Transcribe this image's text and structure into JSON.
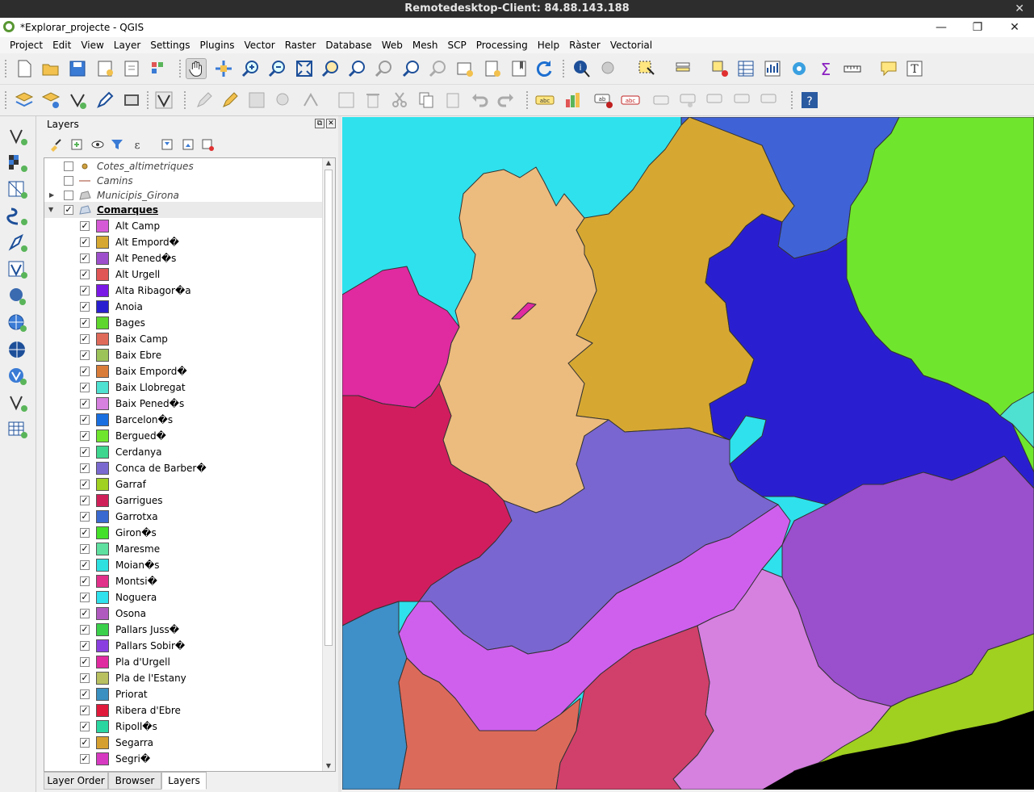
{
  "remote_bar": {
    "title": "Remotedesktop-Client: 84.88.143.188",
    "close": "✕"
  },
  "window": {
    "title": "*Explorar_projecte - QGIS",
    "minimize": "—",
    "restore": "❐",
    "close": "✕"
  },
  "menu": [
    "Project",
    "Edit",
    "View",
    "Layer",
    "Settings",
    "Plugins",
    "Vector",
    "Raster",
    "Database",
    "Web",
    "Mesh",
    "SCP",
    "Processing",
    "Help",
    "Ràster",
    "Vectorial"
  ],
  "panel": {
    "title": "Layers",
    "float": "⧉",
    "close": "✕"
  },
  "layers_top": [
    {
      "name": "Cotes_altimetriques",
      "checked": false
    },
    {
      "name": "Camins",
      "checked": false
    },
    {
      "name": "Municipis_Girona",
      "checked": false
    },
    {
      "name": "Comarques",
      "checked": true
    }
  ],
  "comarques": [
    {
      "name": "Alt Camp",
      "color": "#d55ad6"
    },
    {
      "name": "Alt Empord�",
      "color": "#d6a832"
    },
    {
      "name": "Alt Pened�s",
      "color": "#9e4fcc"
    },
    {
      "name": "Alt Urgell",
      "color": "#e05555"
    },
    {
      "name": "Alta Ribagor�a",
      "color": "#7a18e6"
    },
    {
      "name": "Anoia",
      "color": "#2a1fd0"
    },
    {
      "name": "Bages",
      "color": "#5ed62d"
    },
    {
      "name": "Baix Camp",
      "color": "#e06a5a"
    },
    {
      "name": "Baix Ebre",
      "color": "#9cc25a"
    },
    {
      "name": "Baix Empord�",
      "color": "#d97c3a"
    },
    {
      "name": "Baix Llobregat",
      "color": "#4ee0d0"
    },
    {
      "name": "Baix Pened�s",
      "color": "#d680e0"
    },
    {
      "name": "Barcelon�s",
      "color": "#1a6fe0"
    },
    {
      "name": "Bergued�",
      "color": "#6fe62d"
    },
    {
      "name": "Cerdanya",
      "color": "#3fd690"
    },
    {
      "name": "Conca de Barber�",
      "color": "#7a6ad0"
    },
    {
      "name": "Garraf",
      "color": "#a0d020"
    },
    {
      "name": "Garrigues",
      "color": "#d0205a"
    },
    {
      "name": "Garrotxa",
      "color": "#3a6ad0"
    },
    {
      "name": "Giron�s",
      "color": "#44e02a"
    },
    {
      "name": "Maresme",
      "color": "#5fe0a0"
    },
    {
      "name": "Moian�s",
      "color": "#2ee0e0"
    },
    {
      "name": "Montsi�",
      "color": "#e0308a"
    },
    {
      "name": "Noguera",
      "color": "#2ee1ec"
    },
    {
      "name": "Osona",
      "color": "#b05ac0"
    },
    {
      "name": "Pallars Juss�",
      "color": "#3ad04a"
    },
    {
      "name": "Pallars Sobir�",
      "color": "#8a40e0"
    },
    {
      "name": "Pla d'Urgell",
      "color": "#e02aa0"
    },
    {
      "name": "Pla de l'Estany",
      "color": "#b8c060"
    },
    {
      "name": "Priorat",
      "color": "#3a90c0"
    },
    {
      "name": "Ribera d'Ebre",
      "color": "#e01a3a"
    },
    {
      "name": "Ripoll�s",
      "color": "#2ad6a0"
    },
    {
      "name": "Segarra",
      "color": "#d6a030"
    },
    {
      "name": "Segri�",
      "color": "#d63ac0"
    }
  ],
  "tabs": [
    "Layer Order",
    "Browser",
    "Layers"
  ],
  "map_colors": {
    "noguera": "#2ee1ec",
    "segarra": "#ecbb7e",
    "altempurda": "#d6a832",
    "anoia": "#2a1fd0",
    "garrotxa": "#3f62d6",
    "bergueda": "#6fe62d",
    "plaurgell": "#e02aa0",
    "garrigues": "#d11d5e",
    "conca": "#7a66d0",
    "altcamp": "#cf60ee",
    "baixpenedes": "#d680e0",
    "altpenedes": "#9a4fcc",
    "garraf": "#a0d020",
    "priorat": "#3f8fc8",
    "baixcamp": "#dc6a5a",
    "tarragones": "#d0406a",
    "baixllob": "#4ee0d0",
    "sea": "#000000"
  }
}
